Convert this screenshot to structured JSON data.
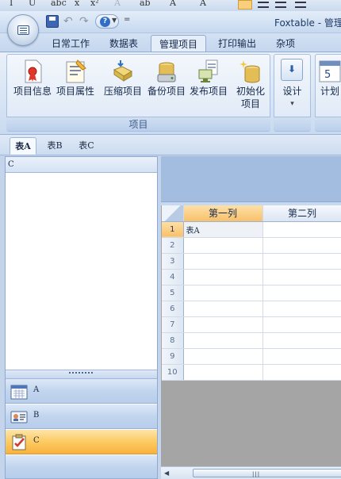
{
  "app": {
    "title": "Foxtable - 管理"
  },
  "format_bar": {
    "glyphs": [
      "I",
      "U",
      "abc",
      "x",
      "x²",
      "A",
      "ab",
      "A",
      "A"
    ]
  },
  "quick_access": {
    "more_label": "="
  },
  "tabs": [
    {
      "label": "日常工作",
      "active": false
    },
    {
      "label": "数据表",
      "active": false
    },
    {
      "label": "管理项目",
      "active": true
    },
    {
      "label": "打印输出",
      "active": false
    },
    {
      "label": "杂项",
      "active": false
    }
  ],
  "ribbon": {
    "group_label": "项目",
    "buttons": {
      "project_info": "项目信息",
      "project_props": "项目属性",
      "compress": "压缩项目",
      "backup": "备份项目",
      "publish": "发布项目",
      "init_line1": "初始化",
      "init_line2": "项目",
      "design": "设计",
      "design_arrow": "▾",
      "plan": "计划"
    }
  },
  "sheet_tabs": [
    {
      "label": "表A",
      "active": true
    },
    {
      "label": "表B",
      "active": false
    },
    {
      "label": "表C",
      "active": false
    }
  ],
  "left_panel": {
    "header": "C",
    "nav": [
      {
        "label": "A",
        "active": false
      },
      {
        "label": "B",
        "active": false
      },
      {
        "label": "C",
        "active": true
      }
    ]
  },
  "grid": {
    "columns": [
      "第一列",
      "第二列"
    ],
    "row_numbers": [
      "1",
      "2",
      "3",
      "4",
      "5",
      "6",
      "7",
      "8",
      "9",
      "10"
    ],
    "rows": [
      [
        "表A",
        ""
      ],
      [
        "",
        ""
      ],
      [
        "",
        ""
      ],
      [
        "",
        ""
      ],
      [
        "",
        ""
      ],
      [
        "",
        ""
      ],
      [
        "",
        ""
      ],
      [
        "",
        ""
      ],
      [
        "",
        ""
      ],
      [
        "",
        ""
      ]
    ]
  },
  "scrollbar": {
    "grip": "|||",
    "left_arrow": "◀"
  }
}
